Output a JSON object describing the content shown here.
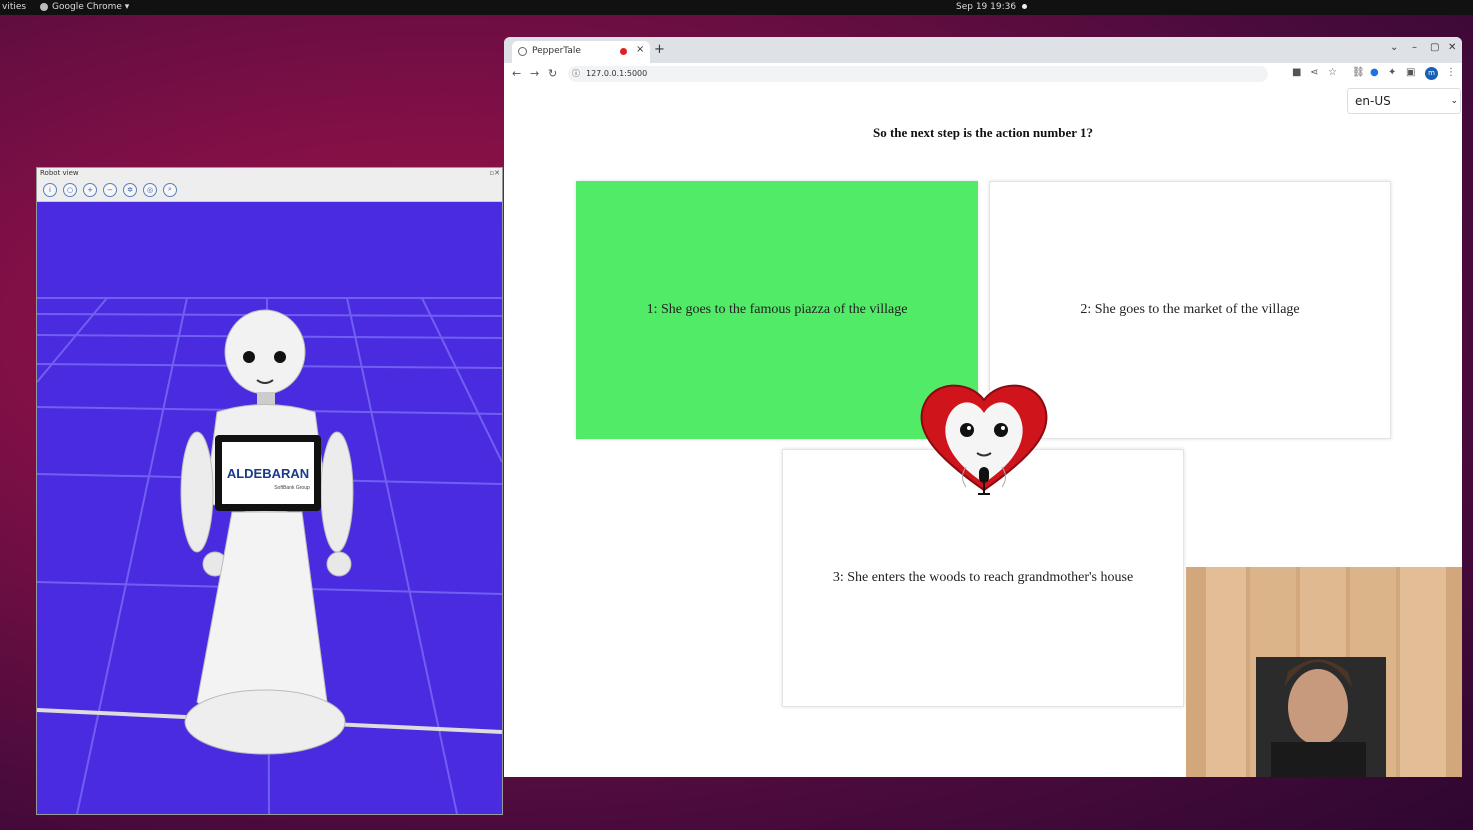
{
  "topbar": {
    "activities": "vities",
    "app_name": "Google Chrome ▾",
    "clock": "Sep 19  19:36"
  },
  "robot_window": {
    "title": "Robot view",
    "tablet_logo": "ALDEBARAN",
    "tablet_sub": "SoftBank Group"
  },
  "browser": {
    "tab_title": "PepperTale",
    "url": "127.0.0.1:5000",
    "profile_initial": "m"
  },
  "page": {
    "language": "en-US",
    "question": "So the next step is the action number 1?",
    "options": [
      {
        "label": "1: She goes to the famous piazza of the village",
        "selected": true
      },
      {
        "label": "2: She goes to the market of the village",
        "selected": false
      },
      {
        "label": "3: She enters the woods to reach grandmother's house",
        "selected": false
      }
    ]
  },
  "colors": {
    "selected_card": "#52eb67",
    "robot_bg": "#4a2be0",
    "mascot_red": "#d0141c"
  }
}
